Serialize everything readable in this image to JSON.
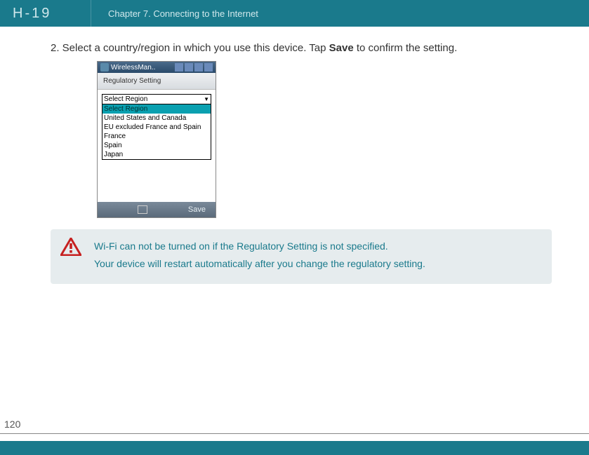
{
  "header": {
    "logo": "H-19",
    "chapter": "Chapter 7. Connecting to the Internet"
  },
  "step": {
    "prefix": "2. Select a country/region in which you use this device. Tap ",
    "bold": "Save",
    "suffix": " to confirm the setting."
  },
  "screenshot": {
    "title": "WirelessMan..",
    "subtitle": "Regulatory Setting",
    "selectLabel": "Select Region",
    "options": {
      "0": "Select Region",
      "1": "United States and Canada",
      "2": "EU excluded France and Spain",
      "3": "France",
      "4": "Spain",
      "5": "Japan"
    },
    "saveButton": "Save"
  },
  "note": {
    "line1": "Wi-Fi can not be turned on if the Regulatory Setting is not specified.",
    "line2": "Your device will restart automatically after you change the regulatory setting."
  },
  "pageNumber": "120"
}
